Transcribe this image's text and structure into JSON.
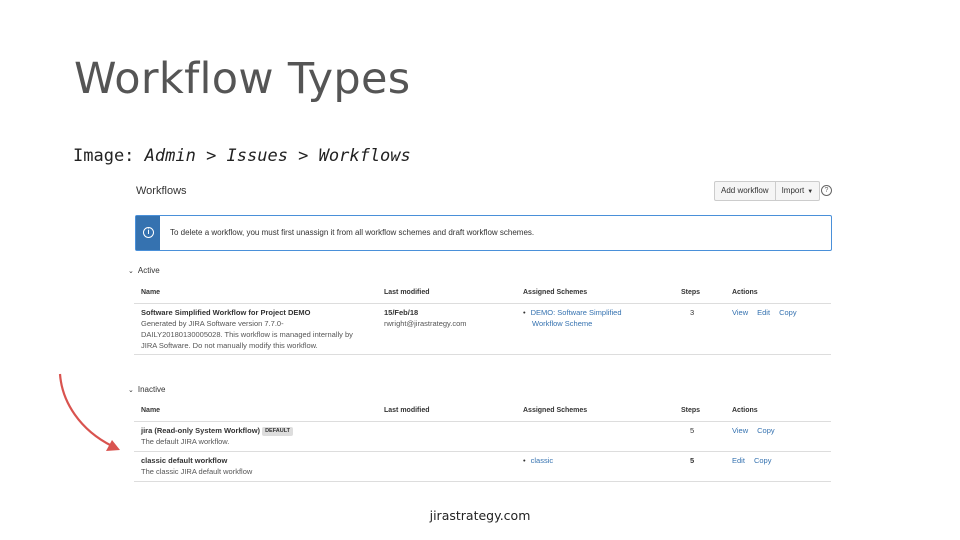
{
  "slide": {
    "title": "Workflow Types",
    "caption_prefix": "Image: ",
    "caption_path": "Admin > Issues > Workflows",
    "footer": "jirastrategy.com"
  },
  "screen": {
    "title": "Workflows",
    "buttons": {
      "add_workflow": "Add workflow",
      "import": "Import"
    },
    "info_message": "To delete a workflow, you must first unassign it from all workflow schemes and draft workflow schemes.",
    "columns": {
      "name": "Name",
      "last_modified": "Last modified",
      "assigned_schemes": "Assigned Schemes",
      "steps": "Steps",
      "actions": "Actions"
    },
    "active": {
      "label": "Active",
      "rows": [
        {
          "name": "Software Simplified Workflow for Project DEMO",
          "desc": [
            "Generated by JIRA Software version 7.7.0-",
            "DAILY20180130005028. This workflow is managed internally by",
            "JIRA Software. Do not manually modify this workflow."
          ],
          "modified_date": "15/Feb/18",
          "modified_by": "rwright@jirastrategy.com",
          "schemes": [
            "DEMO: Software Simplified",
            "Workflow Scheme"
          ],
          "steps": "3",
          "actions": [
            "View",
            "Edit",
            "Copy"
          ]
        }
      ]
    },
    "inactive": {
      "label": "Inactive",
      "rows": [
        {
          "name": "jira (Read-only System Workflow)",
          "badge": "DEFAULT",
          "desc": "The default JIRA workflow.",
          "steps": "5",
          "actions": [
            "View",
            "Copy"
          ]
        },
        {
          "name": "classic default workflow",
          "desc": "The classic JIRA default workflow",
          "scheme": "classic",
          "steps": "5",
          "actions": [
            "Edit",
            "Copy"
          ]
        }
      ]
    }
  },
  "colors": {
    "accent": "#3572b0",
    "arrow": "#d9534f",
    "title": "#555555"
  }
}
